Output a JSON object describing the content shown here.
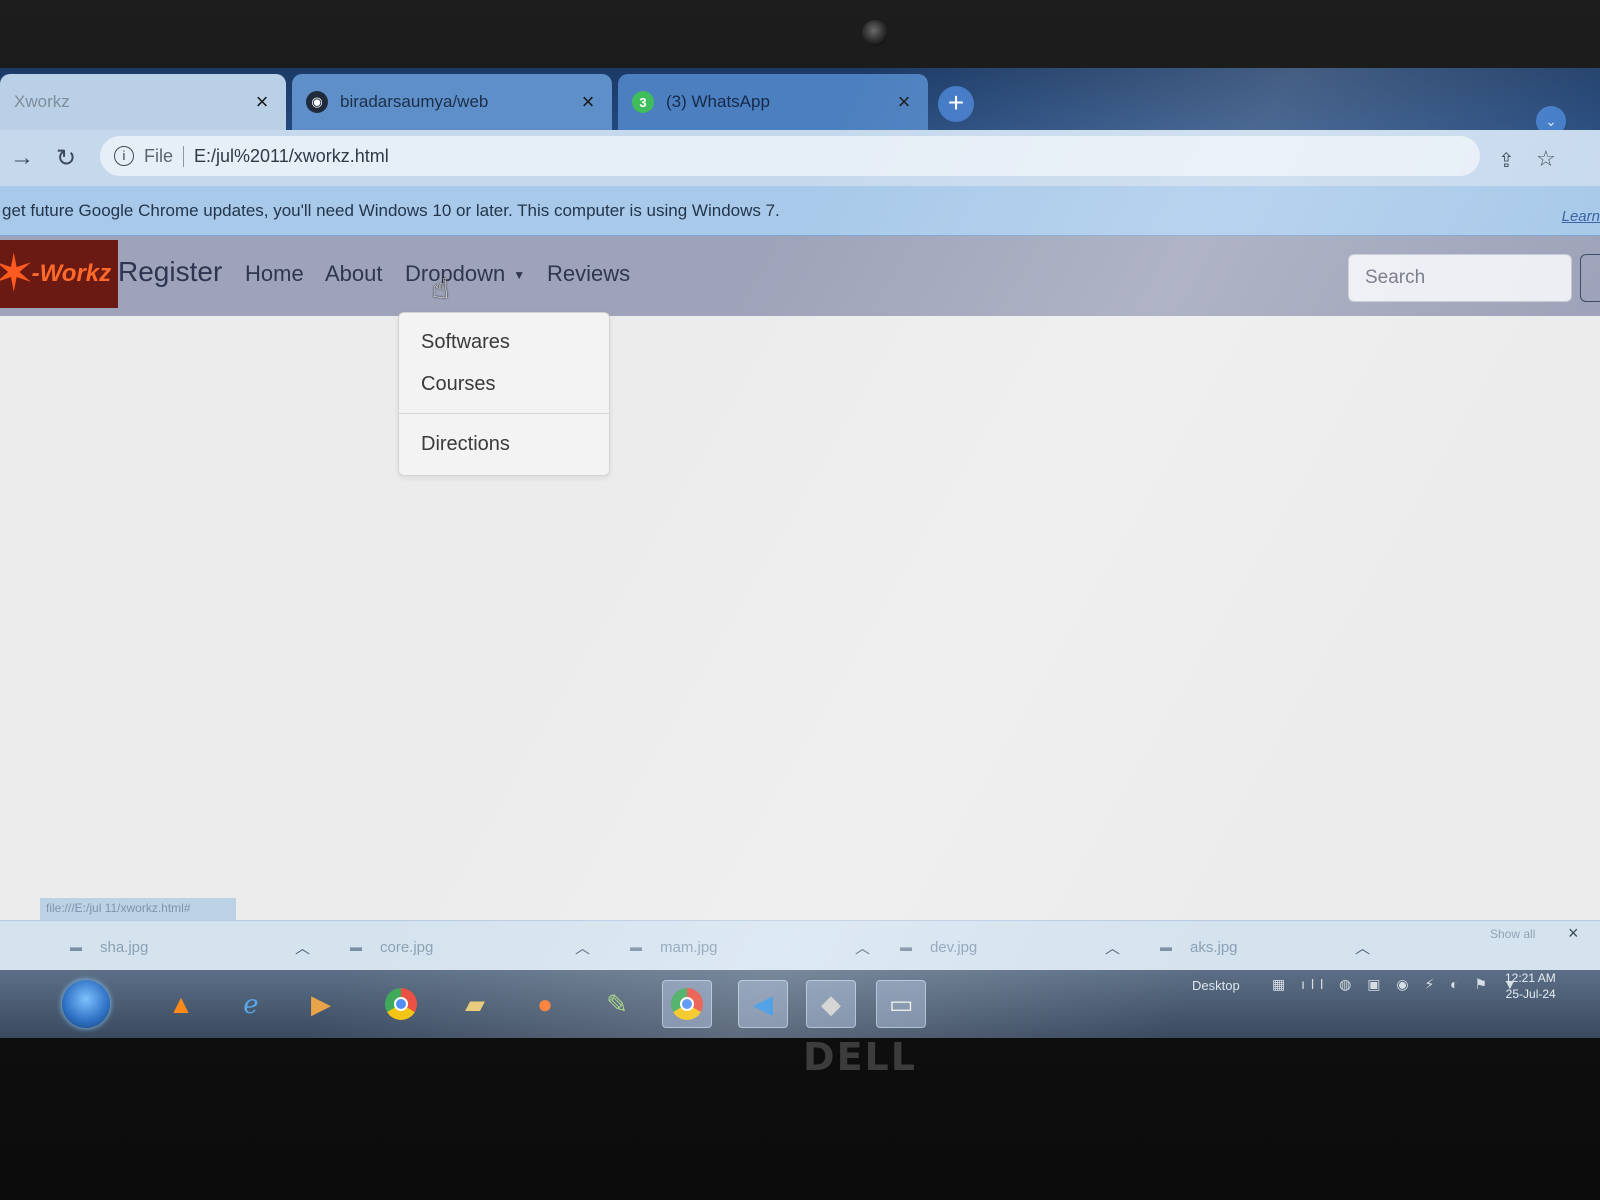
{
  "browser": {
    "tabs": [
      {
        "title": "Xworkz",
        "close": "×"
      },
      {
        "title": "biradarsaumya/web",
        "close": "×",
        "icon": "github-icon"
      },
      {
        "title": "(3) WhatsApp",
        "close": "×",
        "icon": "whatsapp-icon",
        "badge": "3"
      }
    ],
    "new_tab": "+",
    "address": {
      "scheme_label": "File",
      "url": "E:/jul%2011/xworkz.html"
    },
    "infobar": {
      "message": "get future Google Chrome updates, you'll need Windows 10 or later. This computer is using Windows 7.",
      "link": "Learn"
    },
    "status_url": "file:///E:/jul 11/xworkz.html#"
  },
  "site": {
    "logo_text": "-Workz",
    "brand": "Register",
    "nav": {
      "home": "Home",
      "about": "About",
      "dropdown": "Dropdown",
      "reviews": "Reviews"
    },
    "dropdown_items": [
      "Softwares",
      "Courses",
      "Directions"
    ],
    "search_placeholder": "Search"
  },
  "downloads": {
    "items": [
      "sha.jpg",
      "core.jpg",
      "mam.jpg",
      "dev.jpg",
      "aks.jpg"
    ],
    "show_all": "Show all",
    "close": "×"
  },
  "taskbar": {
    "desktop_label": "Desktop",
    "time": "12:21 AM",
    "date": "25-Jul-24"
  },
  "device": {
    "brand": "DELL"
  },
  "colors": {
    "tabstrip": "#1b3a66",
    "navbar": "#9ea3b9",
    "page_background": "#ececec",
    "dropdown_background": "#f3f3f3",
    "whatsapp_green": "#3fbd5a"
  }
}
